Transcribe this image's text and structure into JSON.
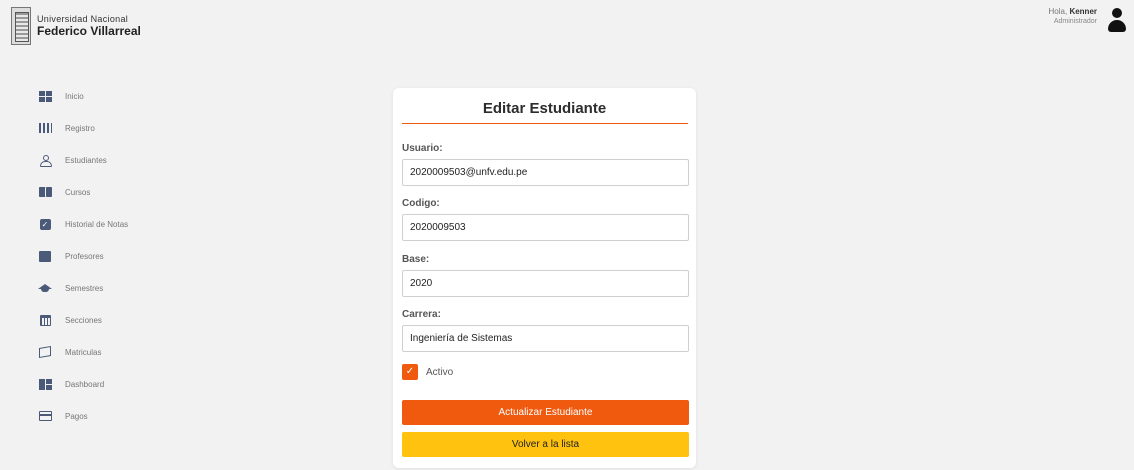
{
  "header": {
    "logo_line1": "Universidad Nacional",
    "logo_line2": "Federico Villarreal",
    "greeting_prefix": "Hola,",
    "user_name": "Kenner",
    "user_role": "Administrador"
  },
  "sidebar": {
    "items": [
      {
        "label": "Inicio",
        "icon": "grid-icon"
      },
      {
        "label": "Registro",
        "icon": "register-icon"
      },
      {
        "label": "Estudiantes",
        "icon": "person-icon"
      },
      {
        "label": "Cursos",
        "icon": "book-icon"
      },
      {
        "label": "Historial de Notas",
        "icon": "checkbox-icon"
      },
      {
        "label": "Profesores",
        "icon": "teacher-icon"
      },
      {
        "label": "Semestres",
        "icon": "graduation-cap-icon"
      },
      {
        "label": "Secciones",
        "icon": "calendar-icon"
      },
      {
        "label": "Matriculas",
        "icon": "enrollment-icon"
      },
      {
        "label": "Dashboard",
        "icon": "dashboard-icon"
      },
      {
        "label": "Pagos",
        "icon": "credit-card-icon"
      }
    ]
  },
  "form": {
    "title": "Editar Estudiante",
    "usuario_label": "Usuario:",
    "usuario_value": "2020009503@unfv.edu.pe",
    "codigo_label": "Codigo:",
    "codigo_value": "2020009503",
    "base_label": "Base:",
    "base_value": "2020",
    "carrera_label": "Carrera:",
    "carrera_value": "Ingeniería de Sistemas",
    "activo_label": "Activo",
    "activo_checked": true,
    "submit_label": "Actualizar Estudiante",
    "back_label": "Volver a la lista"
  },
  "colors": {
    "accent": "#f05a0e",
    "secondary": "#ffc20e",
    "icon": "#4a5a78"
  }
}
